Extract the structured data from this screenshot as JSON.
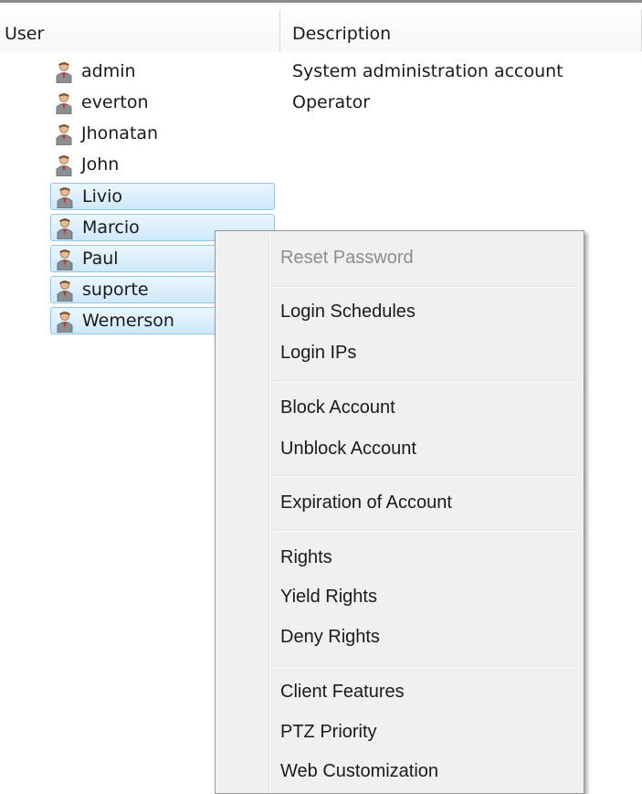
{
  "columns": {
    "user": "User",
    "description": "Description"
  },
  "users": [
    {
      "name": "admin",
      "description": "System administration account",
      "selected": false
    },
    {
      "name": "everton",
      "description": "Operator",
      "selected": false
    },
    {
      "name": "Jhonatan",
      "description": "",
      "selected": false
    },
    {
      "name": "John",
      "description": "",
      "selected": false
    },
    {
      "name": "Livio",
      "description": "",
      "selected": true
    },
    {
      "name": "Marcio",
      "description": "",
      "selected": true
    },
    {
      "name": "Paul",
      "description": "",
      "selected": true
    },
    {
      "name": "suporte",
      "description": "",
      "selected": true
    },
    {
      "name": "Wemerson",
      "description": "",
      "selected": true
    }
  ],
  "context_menu": {
    "reset_password": "Reset Password",
    "login_schedules": "Login Schedules",
    "login_ips": "Login IPs",
    "block_account": "Block Account",
    "unblock_account": "Unblock Account",
    "expiration_of_account": "Expiration of Account",
    "rights": "Rights",
    "yield_rights": "Yield Rights",
    "deny_rights": "Deny Rights",
    "client_features": "Client Features",
    "ptz_priority": "PTZ Priority",
    "web_customization": "Web Customization"
  },
  "icons": {
    "user_row": "user-icon"
  },
  "colors": {
    "selection_fill": "#cfe9fa",
    "selection_border": "#8fc8ee",
    "menu_background": "#f0f0f0",
    "disabled_text": "#8d8d8d"
  }
}
